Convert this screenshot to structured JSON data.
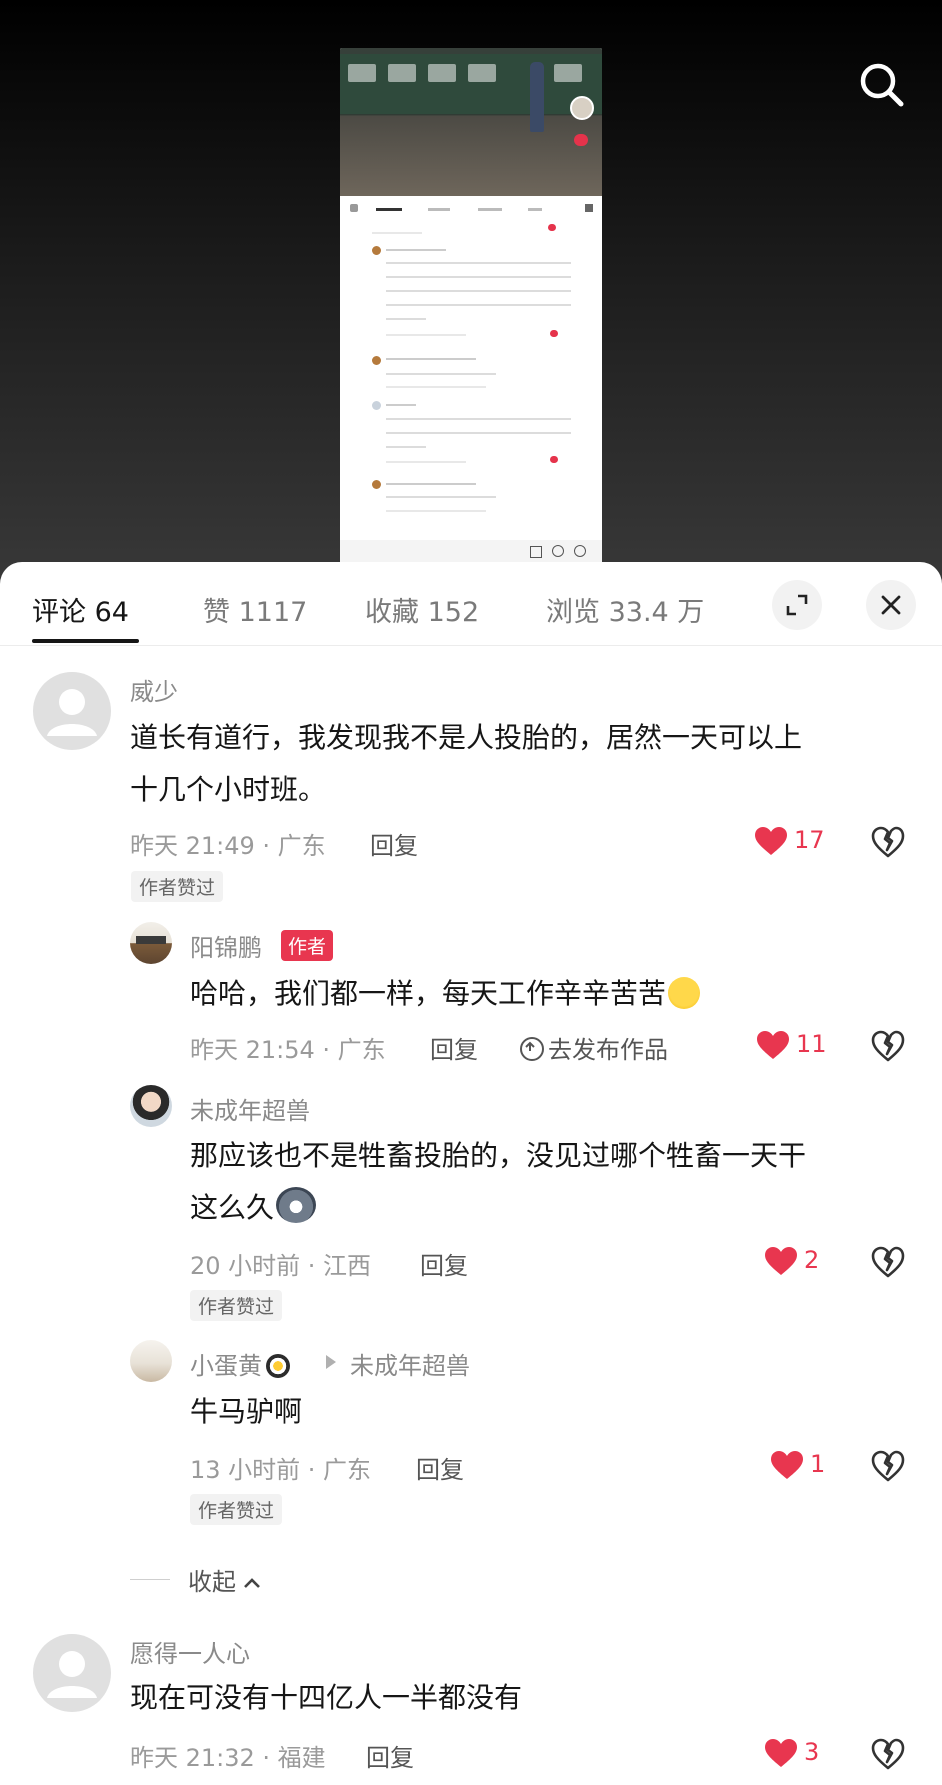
{
  "tabs": [
    {
      "label": "评论 64",
      "active": true
    },
    {
      "label": "赞 1117",
      "active": false
    },
    {
      "label": "收藏 152",
      "active": false
    },
    {
      "label": "浏览 33.4 万",
      "active": false
    }
  ],
  "comments": [
    {
      "name": "威少",
      "text_lines": [
        "道长有道行，我发现我不是人投胎的，居然一天可以上",
        "十几个小时班。"
      ],
      "time": "昨天 21:49 · 广东",
      "reply_label": "回复",
      "likes": "17",
      "badge": "作者赞过"
    },
    {
      "name": "阳锦鹏",
      "author_tag": "作者",
      "text": "哈哈，我们都一样，每天工作辛辛苦苦",
      "time": "昨天 21:54 · 广东",
      "reply_label": "回复",
      "publish_label": "去发布作品",
      "likes": "11"
    },
    {
      "name": "未成年超兽",
      "text_lines": [
        "那应该也不是牲畜投胎的，没见过哪个牲畜一天干",
        "这么久"
      ],
      "time": "20 小时前 · 江西",
      "reply_label": "回复",
      "likes": "2",
      "badge": "作者赞过"
    },
    {
      "name": "小蛋黄",
      "reply_to": "未成年超兽",
      "text": "牛马驴啊",
      "time": "13 小时前 · 广东",
      "reply_label": "回复",
      "likes": "1",
      "badge": "作者赞过"
    },
    {
      "name": "愿得一人心",
      "text": "现在可没有十四亿人一半都没有",
      "time": "昨天 21:32 · 福建",
      "reply_label": "回复",
      "likes": "3"
    }
  ],
  "collapse_label": "收起",
  "colors": {
    "accent": "#e8364f",
    "text": "#161616",
    "muted": "#9a9a9a"
  },
  "icons": [
    "search-icon",
    "expand-icon",
    "close-icon",
    "heart-icon",
    "broken-heart-icon",
    "chevron-up-icon"
  ]
}
